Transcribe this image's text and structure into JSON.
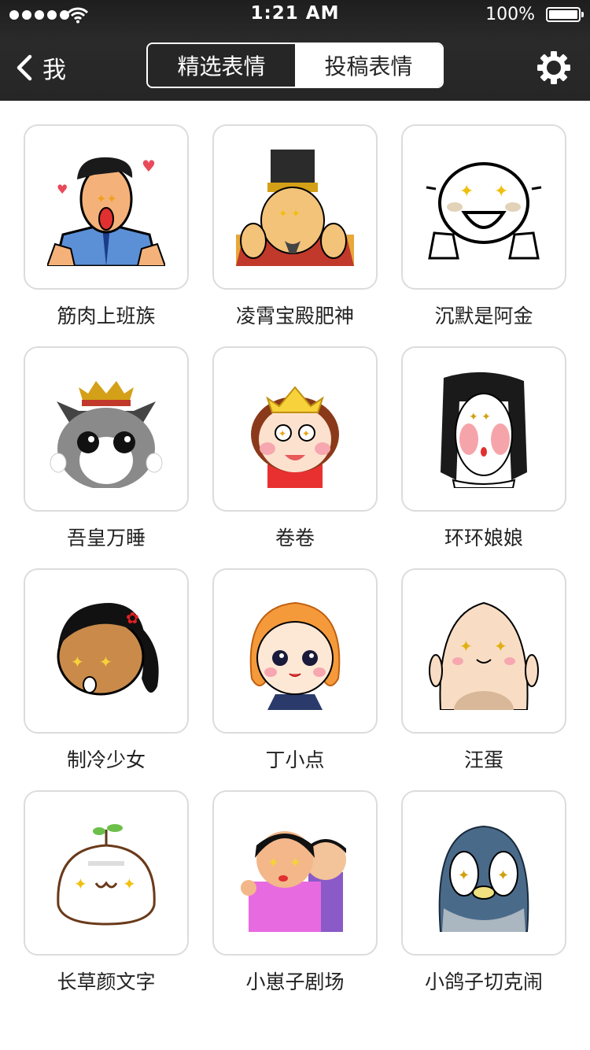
{
  "status_bar": {
    "time": "1:21 AM",
    "battery": "100%"
  },
  "nav": {
    "back_label": "我",
    "tabs": [
      {
        "label": "精选表情",
        "active": true
      },
      {
        "label": "投稿表情",
        "active": false
      }
    ]
  },
  "stickers": [
    {
      "name": "筋肉上班族",
      "icon": "muscle-office-worker-icon"
    },
    {
      "name": "凌霄宝殿肥神",
      "icon": "emperor-icon"
    },
    {
      "name": "沉默是阿金",
      "icon": "bun-face-icon"
    },
    {
      "name": "吾皇万睡",
      "icon": "cat-king-icon"
    },
    {
      "name": "卷卷",
      "icon": "crown-girl-icon"
    },
    {
      "name": "环环娘娘",
      "icon": "concubine-icon"
    },
    {
      "name": "制冷少女",
      "icon": "ponytail-girl-icon"
    },
    {
      "name": "丁小点",
      "icon": "orange-hair-girl-icon"
    },
    {
      "name": "汪蛋",
      "icon": "egg-face-icon"
    },
    {
      "name": "长草颜文字",
      "icon": "sprout-bun-icon"
    },
    {
      "name": "小崽子剧场",
      "icon": "kids-pair-icon"
    },
    {
      "name": "小鸽子切克闹",
      "icon": "pigeon-icon"
    }
  ],
  "colors": {
    "navbar": "#262626",
    "tile_border": "#dcdcdc",
    "label_text": "#222222"
  }
}
